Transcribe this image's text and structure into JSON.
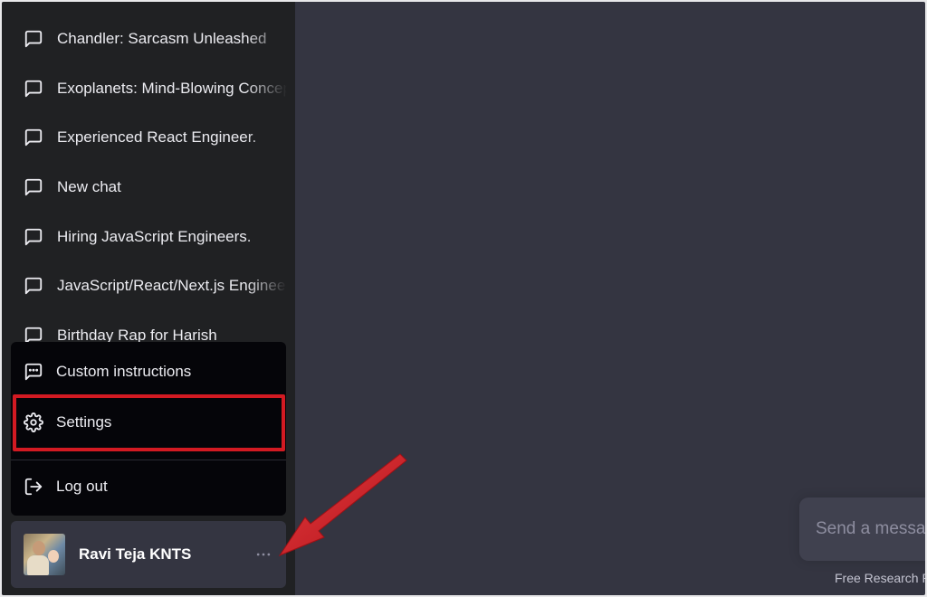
{
  "sidebar": {
    "chats": [
      {
        "label": "Chandler: Sarcasm Unleashed"
      },
      {
        "label": "Exoplanets: Mind-Blowing Concepts"
      },
      {
        "label": "Experienced React Engineer."
      },
      {
        "label": "New chat"
      },
      {
        "label": "Hiring JavaScript Engineers."
      },
      {
        "label": "JavaScript/React/Next.js Engineer"
      },
      {
        "label": "Birthday Rap for Harish"
      }
    ],
    "chat_icon": "message-square-icon"
  },
  "menu": {
    "custom_instructions": "Custom instructions",
    "settings": "Settings",
    "logout": "Log out",
    "icons": {
      "custom_instructions": "message-dots-icon",
      "settings": "gear-icon",
      "logout": "logout-icon"
    }
  },
  "user": {
    "name": "Ravi Teja KNTS",
    "more_icon": "more-horizontal-icon"
  },
  "composer": {
    "placeholder": "Send a message"
  },
  "footer": {
    "note": "Free Research Preview"
  },
  "colors": {
    "sidebar_bg": "#202123",
    "main_bg": "#343541",
    "menu_bg": "#050509",
    "highlight": "#d31a22"
  }
}
